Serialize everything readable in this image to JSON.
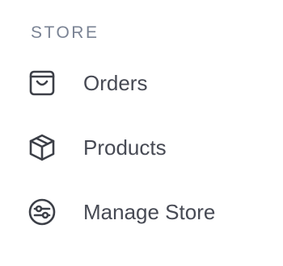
{
  "sidebar": {
    "section_title": "STORE",
    "items": [
      {
        "label": "Orders",
        "icon": "shopping-bag-icon"
      },
      {
        "label": "Products",
        "icon": "box-icon"
      },
      {
        "label": "Manage Store",
        "icon": "sliders-icon"
      }
    ]
  },
  "colors": {
    "heading": "#7a8394",
    "label": "#474a54",
    "icon": "#3c3f47"
  }
}
